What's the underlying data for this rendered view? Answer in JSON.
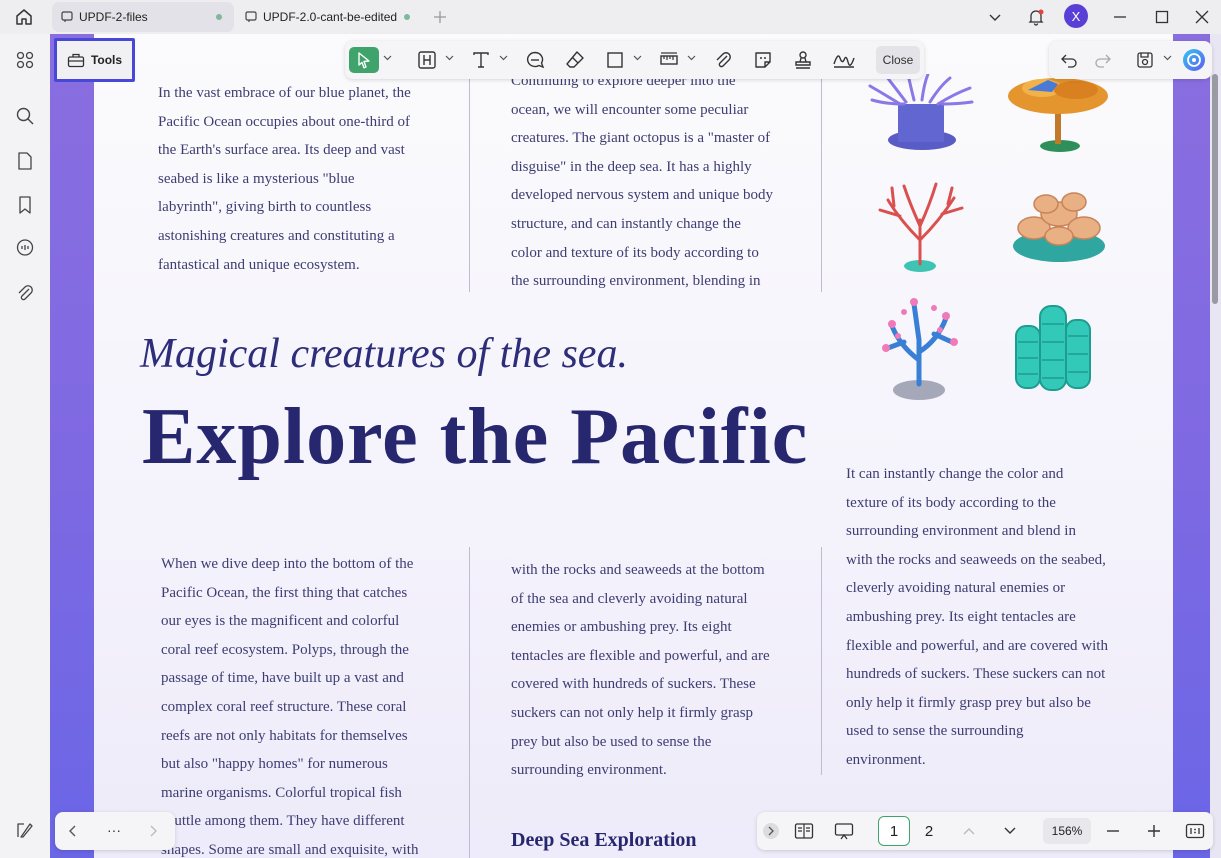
{
  "tabs": [
    {
      "label": "UPDF-2-files",
      "active": true
    },
    {
      "label": "UPDF-2.0-cant-be-edited",
      "active": false
    }
  ],
  "user": {
    "avatar_letter": "X"
  },
  "tools_button": {
    "label": "Tools"
  },
  "toolbar": {
    "close_label": "Close"
  },
  "document": {
    "col1_top": "In the vast embrace of our blue planet, the Pacific Ocean occupies about one-third of the Earth's surface area. Its deep and vast seabed is like a mysterious \"blue labyrinth\", giving birth to countless astonishing creatures and constituting a fantastical and unique ecosystem.",
    "col1_top_lines": [
      "In the vast embrace of our blue planet, the",
      "Pacific Ocean occupies about one-third of",
      "the Earth's surface area. Its deep and vast",
      "seabed is like a mysterious \"blue",
      "labyrinth\", giving birth to countless",
      "astonishing creatures and constituting a",
      "fantastical and unique ecosystem."
    ],
    "col2_top_lines": [
      "Continuing to explore deeper into the",
      "ocean, we will encounter some peculiar",
      "creatures. The giant octopus is a \"master of",
      "disguise\" in the deep sea. It has a highly",
      "developed nervous system and unique body",
      "structure, and can instantly change the",
      "color and texture of its body according to",
      "the surrounding environment, blending in"
    ],
    "script_title": "Magical creatures of the sea.",
    "big_title": "Explore the Pacific",
    "col3_lines": [
      "It can instantly change the color and",
      "texture of its body according to the",
      "surrounding environment and blend in",
      "with the rocks and seaweeds on the seabed,",
      "cleverly avoiding natural enemies or",
      "ambushing prey. Its eight tentacles are",
      "flexible and powerful, and are covered with",
      "hundreds of suckers. These suckers can not",
      "only help it firmly grasp prey but also be",
      "used to sense the surrounding",
      "environment."
    ],
    "col1_bottom_lines": [
      "When we dive deep into the bottom of the",
      "Pacific Ocean, the first thing that catches",
      "our eyes is the magnificent and colorful",
      "coral reef ecosystem. Polyps, through the",
      "passage of time, have built up a vast and",
      "complex coral reef structure. These coral",
      "reefs are not only habitats for themselves",
      "but also \"happy homes\" for numerous",
      "marine organisms. Colorful tropical fish",
      "shuttle among them. They have different",
      "shapes. Some are small and exquisite, with"
    ],
    "col2_bottom_lines": [
      "with the rocks and seaweeds at the bottom",
      "of the sea and cleverly avoiding natural",
      "enemies or ambushing prey. Its eight",
      "tentacles are flexible and powerful, and are",
      "covered with hundreds of suckers. These",
      "suckers can not only help it firmly grasp",
      "prey but also be used to sense the",
      "surrounding environment."
    ],
    "subheading": "Deep Sea Exploration"
  },
  "page_nav": {
    "more_label": "···"
  },
  "zoom_bar": {
    "pages": [
      "1",
      "2"
    ],
    "current_page": 1,
    "zoom": "156%"
  },
  "colors": {
    "accent_green": "#3fa36b",
    "title_navy": "#26276f",
    "tools_highlight": "#4748d8"
  }
}
